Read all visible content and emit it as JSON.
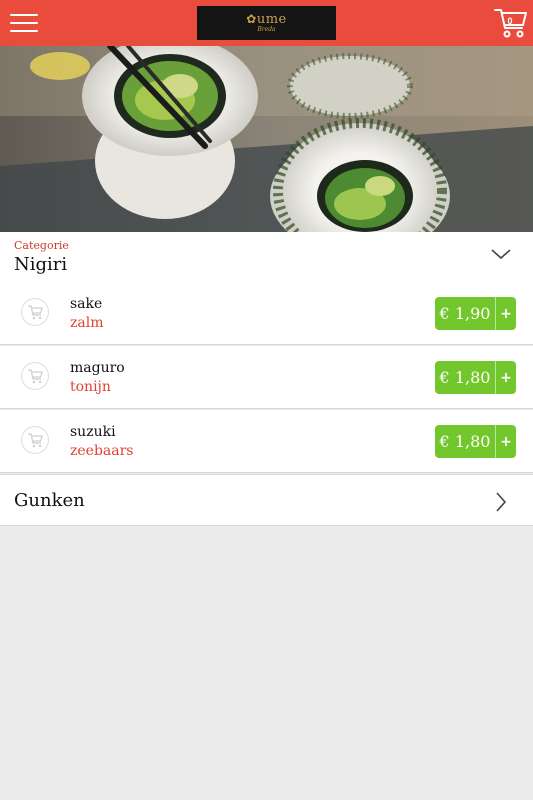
{
  "header": {
    "logo_mark": "ume",
    "logo_sub": "Breda",
    "cart_count": "0",
    "menu_icon": "hamburger-icon",
    "cart_icon": "cart-icon",
    "brand_color": "#e94b3c"
  },
  "hero": {
    "image": "sushi-roll-photo"
  },
  "category": {
    "label": "Categorie",
    "name": "Nigiri",
    "toggle_icon": "chevron-down-icon"
  },
  "items": [
    {
      "name": "sake",
      "subtitle": "zalm",
      "price": "€ 1,90",
      "add_label": "+"
    },
    {
      "name": "maguro",
      "subtitle": "tonijn",
      "price": "€ 1,80",
      "add_label": "+"
    },
    {
      "name": "suzuki",
      "subtitle": "zeebaars",
      "price": "€ 1,80",
      "add_label": "+"
    }
  ],
  "next_category": {
    "name": "Gunken",
    "icon": "chevron-right-icon"
  },
  "colors": {
    "accent_red": "#e94b3c",
    "price_green": "#72c72d",
    "subtitle_red": "#e2412f"
  }
}
